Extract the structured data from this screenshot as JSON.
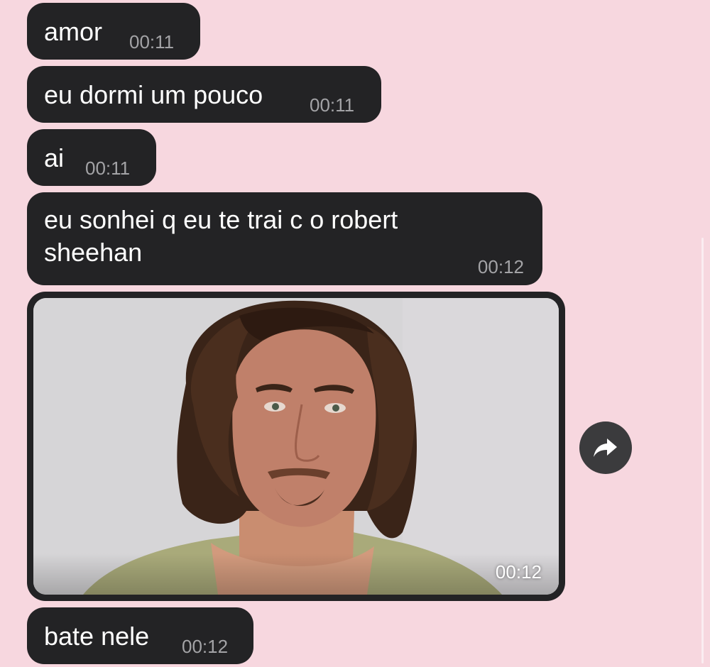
{
  "messages": [
    {
      "text": "amor",
      "time": "00:11"
    },
    {
      "text": "eu dormi um pouco",
      "time": "00:11"
    },
    {
      "text": "ai",
      "time": "00:11"
    },
    {
      "text": "eu sonhei q eu te trai c o robert sheehan",
      "time": "00:12"
    },
    {
      "type": "photo",
      "time": "00:12"
    },
    {
      "text": "bate nele",
      "time": "00:12"
    }
  ],
  "icons": {
    "share": "share-arrow-icon"
  },
  "colors": {
    "background": "#f7d7df",
    "bubble": "#232325",
    "time": "#a3a3a6"
  }
}
